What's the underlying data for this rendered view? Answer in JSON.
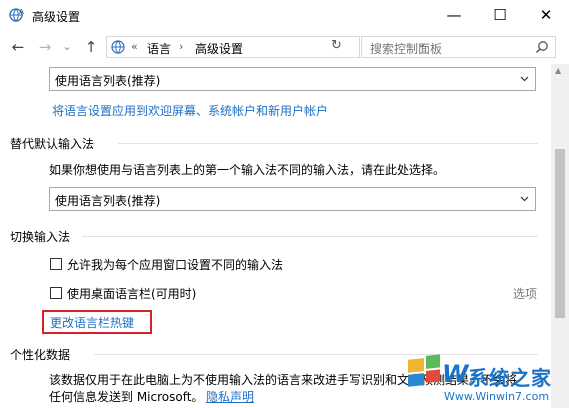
{
  "window": {
    "title": "高级设置",
    "min_glyph": "—",
    "max_glyph": "☐",
    "close_glyph": "✕"
  },
  "nav": {
    "back": "←",
    "forward": "→",
    "recent": "⌄",
    "up": "↑"
  },
  "address": {
    "chevron": "«",
    "parts": [
      "语言",
      "高级设置"
    ],
    "separator": "›",
    "dropdown": "⌄",
    "refresh": "↻"
  },
  "search": {
    "placeholder": "搜索控制面板"
  },
  "top_select": {
    "value": "使用语言列表(推荐)"
  },
  "apply_link": "将语言设置应用到欢迎屏幕、系统帐户和新用户帐户",
  "override_input": {
    "heading": "替代默认输入法",
    "description": "如果你想使用与语言列表上的第一个输入法不同的输入法，请在此处选择。",
    "select_value": "使用语言列表(推荐)"
  },
  "switch_input": {
    "heading": "切换输入法",
    "checkbox1": "允许我为每个应用窗口设置不同的输入法",
    "checkbox2": "使用桌面语言栏(可用时)",
    "options_link": "选项",
    "hotkeys_link": "更改语言栏热键"
  },
  "personalization": {
    "heading": "个性化数据",
    "line1": "该数据仅用于在此电脑上为不使用输入法的语言来改进手写识别和文本预测结果。不会将",
    "line2_prefix": "任何信息发送到 Microsoft。",
    "privacy_link": "隐私声明"
  },
  "watermark": {
    "brand_w": "W",
    "brand_cn": "系统之家",
    "url": "Www.Winwin7.com"
  },
  "colors": {
    "link": "#1e6fc8",
    "highlight_border": "#d6232a",
    "watermark_blue": "#1a73c9"
  }
}
